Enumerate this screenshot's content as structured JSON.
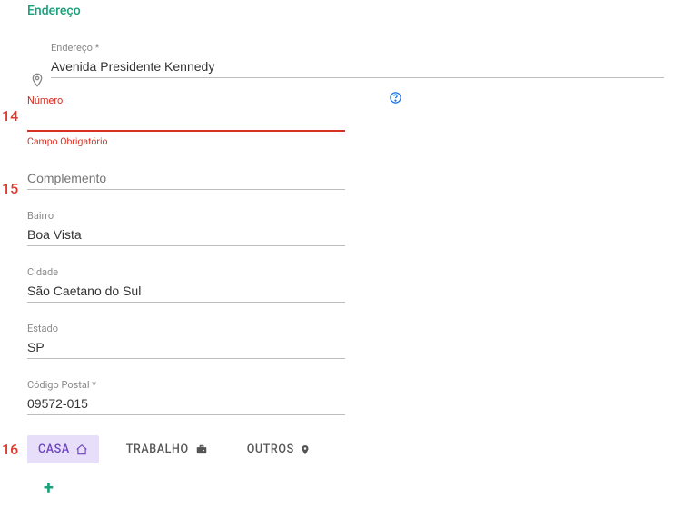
{
  "section": {
    "title": "Endereço"
  },
  "markers": {
    "m14": "14",
    "m15": "15",
    "m16": "16"
  },
  "address": {
    "label": "Endereço *",
    "value": "Avenida Presidente Kennedy"
  },
  "number": {
    "label": "Número",
    "value": "",
    "helper": "Campo Obrigatório"
  },
  "complement": {
    "label": "Complemento",
    "value": ""
  },
  "bairro": {
    "label": "Bairro",
    "value": "Boa Vista"
  },
  "cidade": {
    "label": "Cidade",
    "value": "São Caetano do Sul"
  },
  "estado": {
    "label": "Estado",
    "value": "SP"
  },
  "postal": {
    "label": "Código Postal *",
    "value": "09572-015"
  },
  "tags": {
    "casa": "CASA",
    "trabalho": "TRABALHO",
    "outros": "OUTROS"
  },
  "add": "+"
}
